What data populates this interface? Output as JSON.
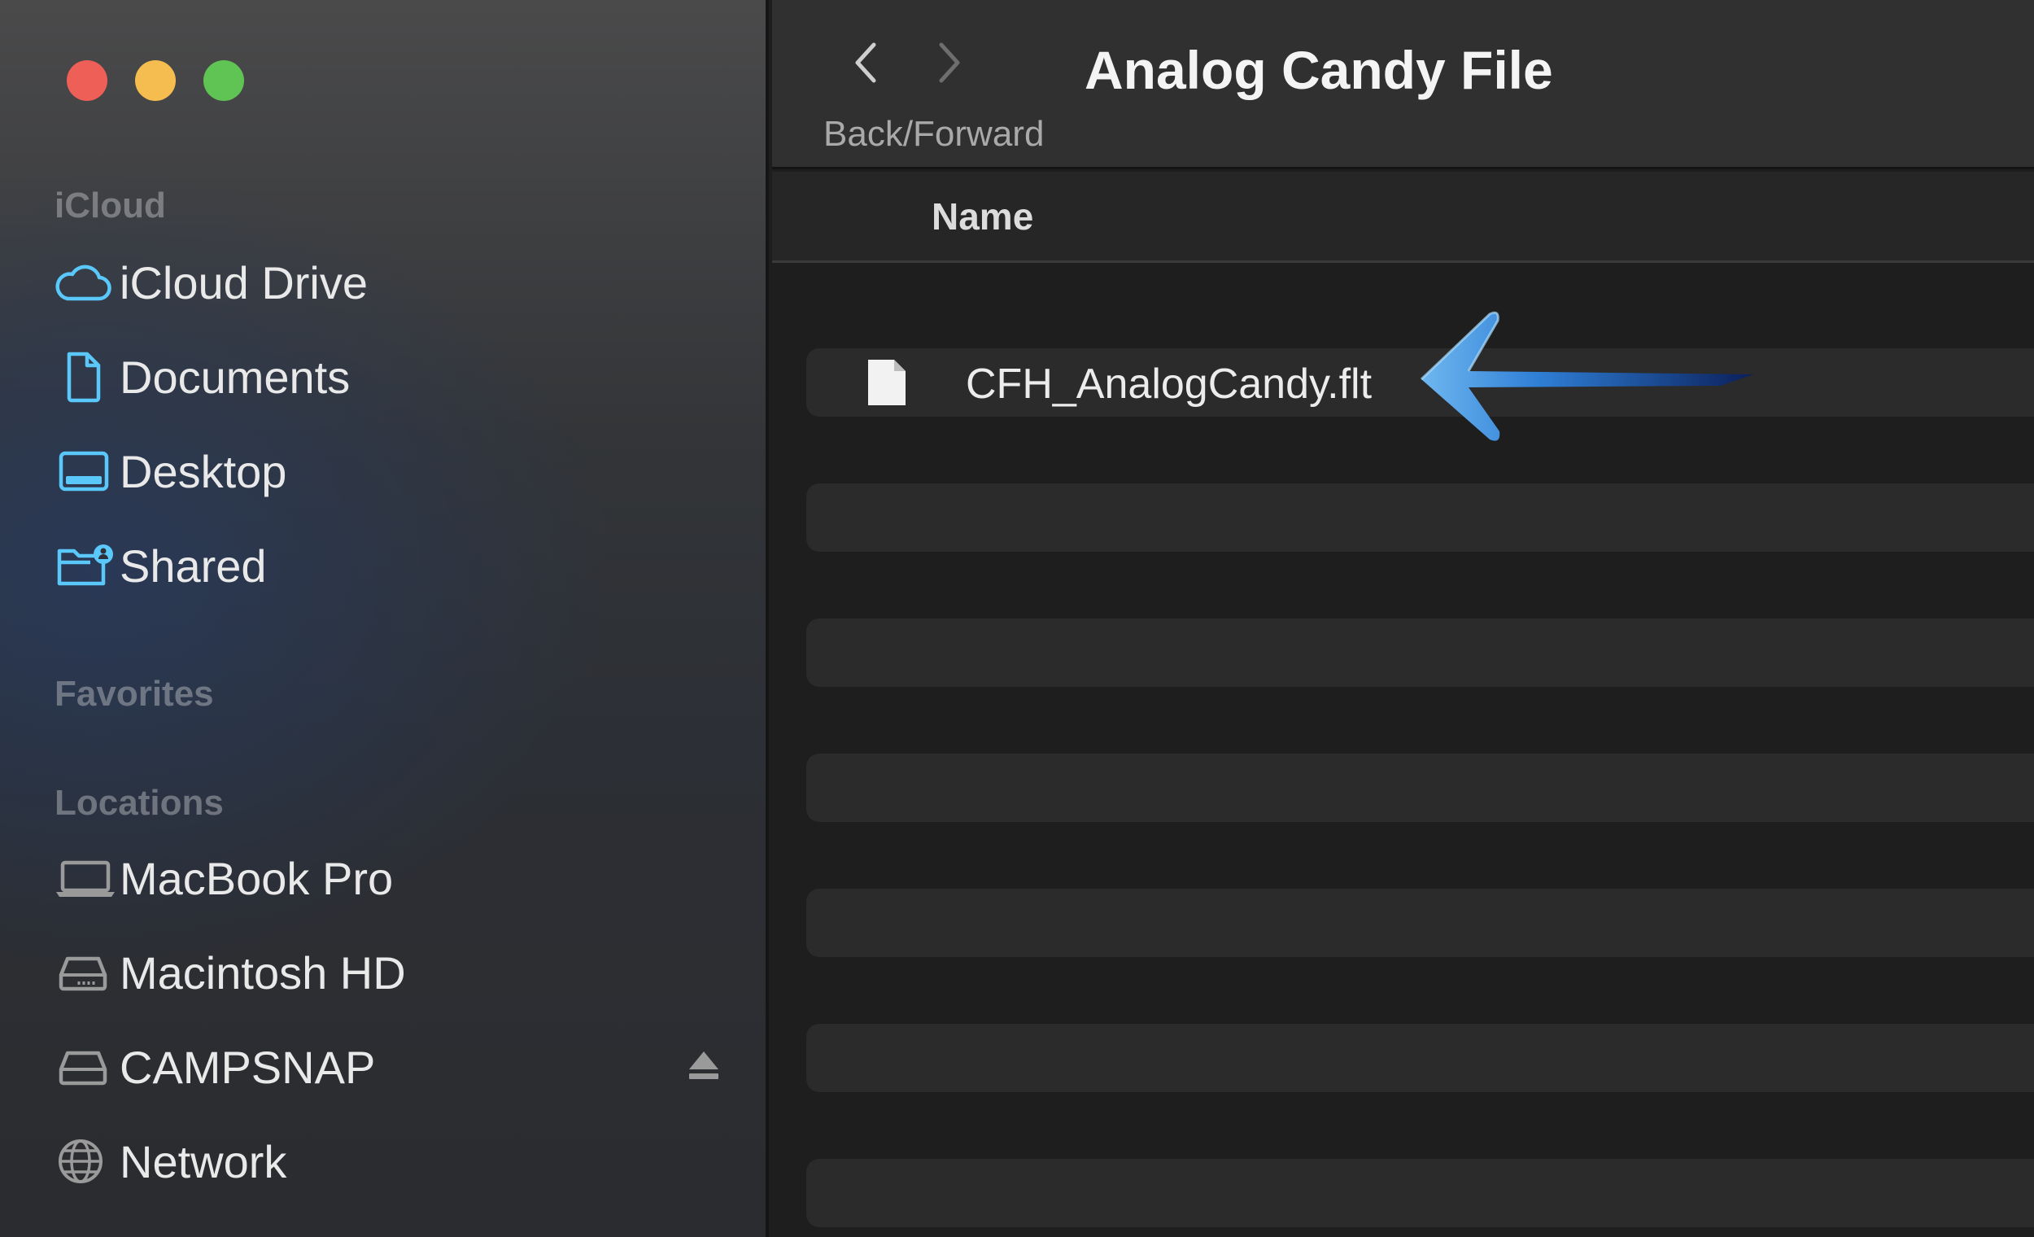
{
  "window": {
    "title": "Analog Candy File",
    "toolbar_hint": "Back/Forward"
  },
  "sidebar": {
    "sections": {
      "icloud": "iCloud",
      "favorites": "Favorites",
      "locations": "Locations"
    },
    "icloud_items": [
      {
        "label": "iCloud Drive",
        "icon": "cloud-icon"
      },
      {
        "label": "Documents",
        "icon": "document-icon"
      },
      {
        "label": "Desktop",
        "icon": "desktop-icon"
      },
      {
        "label": "Shared",
        "icon": "shared-folder-icon"
      }
    ],
    "location_items": [
      {
        "label": "MacBook Pro",
        "icon": "laptop-icon"
      },
      {
        "label": "Macintosh HD",
        "icon": "hard-drive-icon"
      },
      {
        "label": "CAMPSNAP",
        "icon": "external-drive-icon"
      },
      {
        "label": "Network",
        "icon": "globe-icon"
      }
    ]
  },
  "list": {
    "column_name": "Name",
    "files": [
      {
        "name": "CFH_AnalogCandy.flt",
        "icon": "generic-file-icon"
      }
    ]
  },
  "colors": {
    "accent": "#5ac8fa",
    "close": "#ee5f57",
    "minimize": "#f5bd4f",
    "zoom": "#5fc454",
    "annotation_arrow": "#2f7fd6"
  }
}
